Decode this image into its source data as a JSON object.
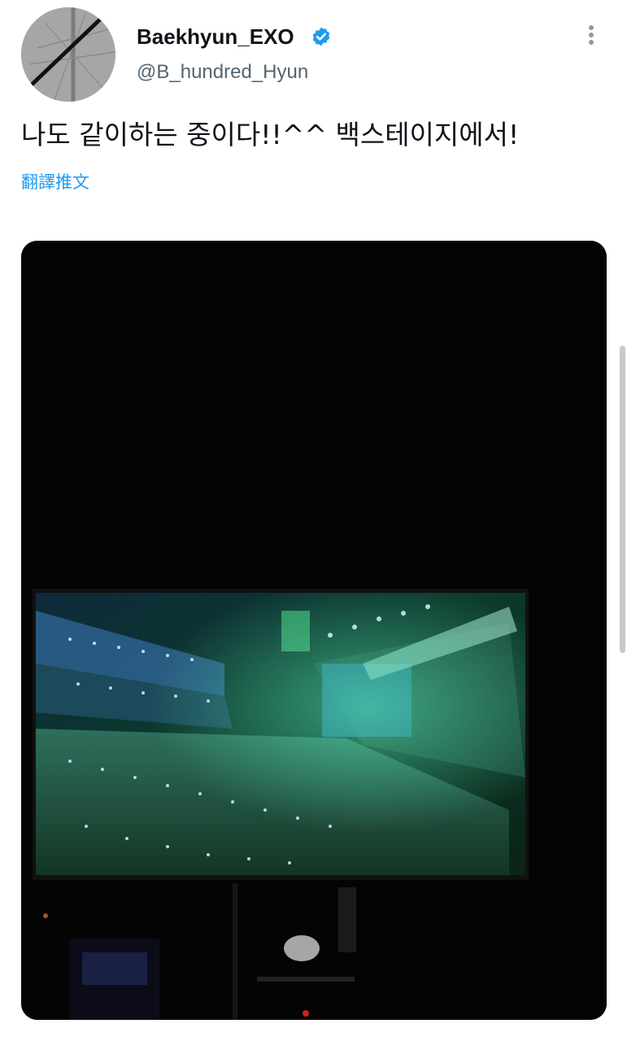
{
  "tweet": {
    "display_name": "Baekhyun_EXO",
    "handle": "@B_hundred_Hyun",
    "text": "나도 같이하는 중이다!!^^ 백스테이지에서!",
    "translate_label": "翻譯推文",
    "verified": true,
    "avatar_icon": "exo-logo-icon",
    "more_icon": "more-vertical-icon"
  },
  "colors": {
    "accent": "#1d9bf0",
    "text": "#0f1419",
    "secondary": "#536471",
    "avatar_bg": "#a6a6a6",
    "media_bg": "#040404"
  }
}
